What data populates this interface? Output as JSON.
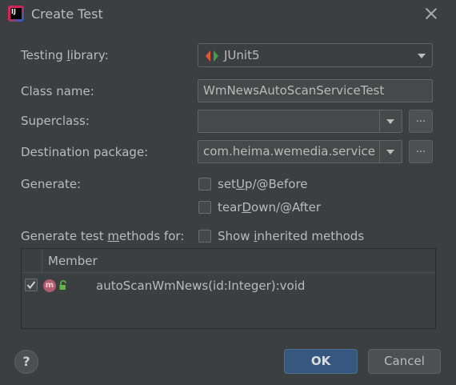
{
  "window": {
    "title": "Create Test",
    "app_icon_text": "IJ"
  },
  "form": {
    "testing_library": {
      "label_pre": "Testing ",
      "label_mnemonic": "l",
      "label_post": "ibrary:",
      "value": "JUnit5"
    },
    "class_name": {
      "label": "Class name:",
      "value": "WmNewsAutoScanServiceTest"
    },
    "superclass": {
      "label": "Superclass:",
      "value": "",
      "browse": "..."
    },
    "destination_package": {
      "label": "Destination package:",
      "value": "com.heima.wemedia.service",
      "browse": "..."
    },
    "generate": {
      "label": "Generate:",
      "setup": {
        "pre": "set",
        "mnemonic": "U",
        "post": "p/@Before",
        "checked": false
      },
      "teardown": {
        "pre": "tear",
        "mnemonic": "D",
        "post": "own/@After",
        "checked": false
      }
    },
    "methods_for": {
      "label_pre": "Generate test ",
      "label_mnemonic": "m",
      "label_post": "ethods for:"
    },
    "show_inherited": {
      "pre": "Show ",
      "mnemonic": "i",
      "post": "nherited methods",
      "checked": false
    }
  },
  "members_table": {
    "header": "Member",
    "rows": [
      {
        "checked": true,
        "name": "autoScanWmNews(id:Integer):void",
        "icon_letter": "m"
      }
    ]
  },
  "buttons": {
    "help": "?",
    "ok": "OK",
    "cancel": "Cancel"
  },
  "colors": {
    "background": "#3c3f41",
    "primary_button": "#365880",
    "method_icon": "#b25c6d",
    "lock_icon": "#62b543",
    "junit_green": "#43a047",
    "junit_red": "#e4572e"
  }
}
